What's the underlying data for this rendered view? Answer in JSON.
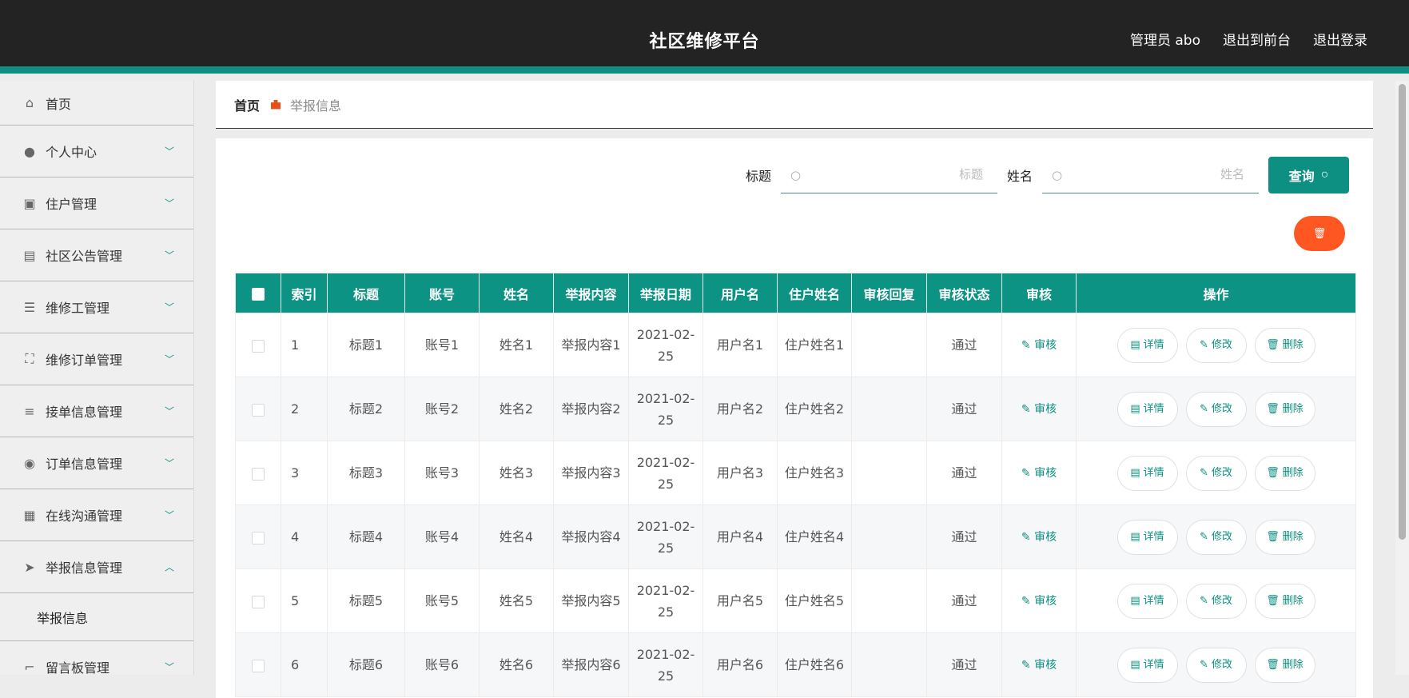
{
  "header": {
    "title": "社区维修平台",
    "user": "管理员 abo",
    "front_link": "退出到前台",
    "logout": "退出登录"
  },
  "sidebar": {
    "items": [
      {
        "label": "首页",
        "icon": "home-icon",
        "glyph": "⌂",
        "expanded": false
      },
      {
        "label": "个人中心",
        "icon": "user-icon",
        "glyph": "●",
        "expanded": false
      },
      {
        "label": "住户管理",
        "icon": "clipboard-icon",
        "glyph": "▣",
        "expanded": false
      },
      {
        "label": "社区公告管理",
        "icon": "brush-icon",
        "glyph": "▤",
        "expanded": false
      },
      {
        "label": "维修工管理",
        "icon": "list-icon",
        "glyph": "☰",
        "expanded": false
      },
      {
        "label": "维修订单管理",
        "icon": "frame-icon",
        "glyph": "⛶",
        "expanded": false
      },
      {
        "label": "接单信息管理",
        "icon": "sliders-icon",
        "glyph": "≡",
        "expanded": false
      },
      {
        "label": "订单信息管理",
        "icon": "bulb-icon",
        "glyph": "◉",
        "expanded": false
      },
      {
        "label": "在线沟通管理",
        "icon": "grid-icon",
        "glyph": "▦",
        "expanded": false
      },
      {
        "label": "举报信息管理",
        "icon": "send-icon",
        "glyph": "➤",
        "expanded": true
      },
      {
        "label": "留言板管理",
        "icon": "crop-icon",
        "glyph": "⌐",
        "expanded": false
      }
    ],
    "submenu": "举报信息"
  },
  "breadcrumb": {
    "home": "首页",
    "current": "举报信息"
  },
  "search": {
    "title_label": "标题",
    "title_placeholder": "标题",
    "name_label": "姓名",
    "name_placeholder": "姓名",
    "query_label": "查询"
  },
  "table": {
    "headers": [
      "索引",
      "标题",
      "账号",
      "姓名",
      "举报内容",
      "举报日期",
      "用户名",
      "住户姓名",
      "审核回复",
      "审核状态",
      "审核",
      "操作"
    ],
    "audit_label": "审核",
    "detail_label": "详情",
    "edit_label": "修改",
    "delete_label": "删除",
    "rows": [
      {
        "index": "1",
        "title": "标题1",
        "account": "账号1",
        "name": "姓名1",
        "content": "举报内容1",
        "date": "2021-02-25",
        "username": "用户名1",
        "resident": "住户姓名1",
        "reply": "",
        "status": "通过"
      },
      {
        "index": "2",
        "title": "标题2",
        "account": "账号2",
        "name": "姓名2",
        "content": "举报内容2",
        "date": "2021-02-25",
        "username": "用户名2",
        "resident": "住户姓名2",
        "reply": "",
        "status": "通过"
      },
      {
        "index": "3",
        "title": "标题3",
        "account": "账号3",
        "name": "姓名3",
        "content": "举报内容3",
        "date": "2021-02-25",
        "username": "用户名3",
        "resident": "住户姓名3",
        "reply": "",
        "status": "通过"
      },
      {
        "index": "4",
        "title": "标题4",
        "account": "账号4",
        "name": "姓名4",
        "content": "举报内容4",
        "date": "2021-02-25",
        "username": "用户名4",
        "resident": "住户姓名4",
        "reply": "",
        "status": "通过"
      },
      {
        "index": "5",
        "title": "标题5",
        "account": "账号5",
        "name": "姓名5",
        "content": "举报内容5",
        "date": "2021-02-25",
        "username": "用户名5",
        "resident": "住户姓名5",
        "reply": "",
        "status": "通过"
      },
      {
        "index": "6",
        "title": "标题6",
        "account": "账号6",
        "name": "姓名6",
        "content": "举报内容6",
        "date": "2021-02-25",
        "username": "用户名6",
        "resident": "住户姓名6",
        "reply": "",
        "status": "通过"
      }
    ]
  },
  "colors": {
    "accent": "#0d8f82",
    "danger": "#ff5722",
    "topbar": "#232323"
  }
}
